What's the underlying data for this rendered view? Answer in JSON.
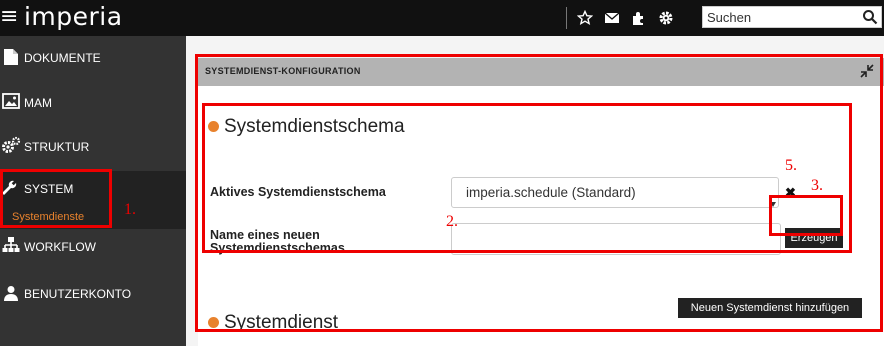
{
  "app": {
    "logo_text": "imperia"
  },
  "header": {
    "search": {
      "placeholder": "Suchen",
      "value": ""
    },
    "icons": [
      "star-icon",
      "envelope-icon",
      "plugin-icon",
      "gear-icon",
      "search-icon"
    ]
  },
  "sidebar": {
    "items": [
      {
        "label": "DOKUMENTE",
        "icon": "document-icon"
      },
      {
        "label": "MAM",
        "icon": "image-icon"
      },
      {
        "label": "STRUKTUR",
        "icon": "cogs-icon"
      },
      {
        "label": "SYSTEM",
        "icon": "wrench-icon",
        "active": true,
        "sub": "Systemdienste"
      },
      {
        "label": "WORKFLOW",
        "icon": "sitemap-icon"
      },
      {
        "label": "BENUTZERKONTO",
        "icon": "user-icon"
      }
    ]
  },
  "panel": {
    "title": "SYSTEMDIENST-KONFIGURATION",
    "section1": {
      "title": "Systemdienstschema",
      "active_label": "Aktives Systemdienstschema",
      "active_value": "imperia.schedule (Standard)",
      "name_label_line1": "Name eines neuen",
      "name_label_line2": "Systemdienstschemas",
      "name_value": "",
      "create_button": "Erzeugen",
      "clear_symbol": "✖"
    },
    "add_button": "Neuen Systemdienst hinzufügen",
    "section2": {
      "title": "Systemdienst"
    }
  },
  "annotations": [
    "1.",
    "2.",
    "3.",
    "5."
  ],
  "colors": {
    "accent": "#e8822d",
    "annotation": "#e00000",
    "sidebar": "#333333",
    "topbar": "#111111"
  }
}
